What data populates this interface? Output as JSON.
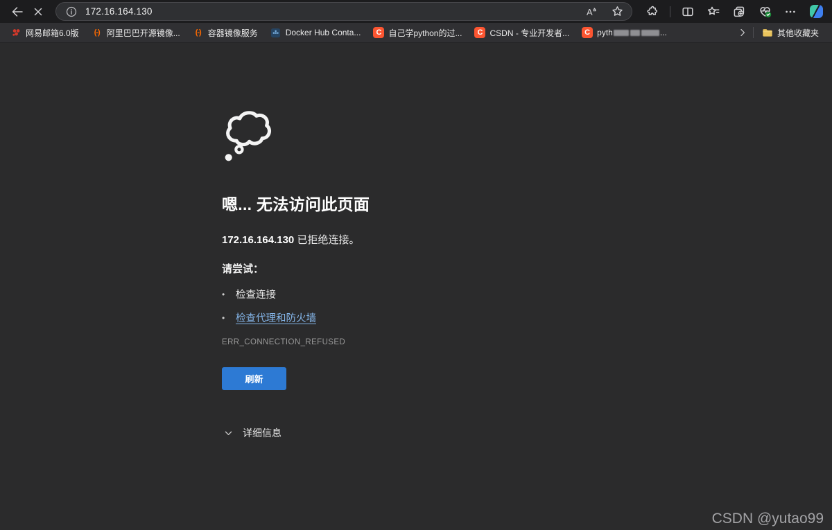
{
  "toolbar": {
    "url": "172.16.164.130"
  },
  "bookmarks_bar": {
    "items": [
      {
        "label": "网易邮箱6.0版",
        "icon": "netease"
      },
      {
        "label": "阿里巴巴开源镜像...",
        "icon": "aliyun"
      },
      {
        "label": "容器镜像服务",
        "icon": "aliyun"
      },
      {
        "label": "Docker Hub Conta...",
        "icon": "docker"
      },
      {
        "label": "自己学python的过...",
        "icon": "csdn"
      },
      {
        "label": "CSDN - 专业开发者...",
        "icon": "csdn"
      },
      {
        "label": "pyth",
        "suffix": "...",
        "redacted": true,
        "icon": "csdn"
      }
    ],
    "aliyun_glyph": "(-)",
    "csdn_glyph": "C",
    "other_favorites": "其他收藏夹"
  },
  "error_page": {
    "title": "嗯... 无法访问此页面",
    "host": "172.16.164.130",
    "message_suffix": " 已拒绝连接。",
    "try_heading": "请尝试：",
    "bullet": "•",
    "suggestions": [
      {
        "label": "检查连接",
        "is_link": false
      },
      {
        "label": "检查代理和防火墙",
        "is_link": true
      }
    ],
    "error_code": "ERR_CONNECTION_REFUSED",
    "refresh_button": "刷新",
    "details_label": "详细信息"
  },
  "watermark": "CSDN @yutao99",
  "colors": {
    "toolbar_bg": "#1c1c1e",
    "bookmarks_bg": "#303033",
    "page_bg": "#2b2b2c",
    "accent_button_blue": "#2d7ad4",
    "link_blue": "#84b5e9",
    "favicon_csdn_red": "#fc5531",
    "favicon_aliyun_orange": "#ff6a00",
    "essentials_badge_green": "#1d8a3a",
    "folder_yellow": "#e9c35c"
  }
}
